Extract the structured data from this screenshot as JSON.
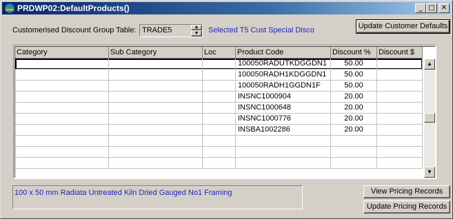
{
  "window": {
    "title": "PRDWP02:DefaultProducts()",
    "min_glyph": "_",
    "max_glyph": "□",
    "close_glyph": "✕"
  },
  "discount_group": {
    "label": "Customerised Discount Group Table:",
    "value": "TRADE5",
    "selected_text": "Selected T5 Cust Special Disco"
  },
  "buttons": {
    "update_customer_defaults": "Update Customer Defaults",
    "view_pricing_records": "View Pricing Records",
    "update_pricing_records": "Update Pricing Records"
  },
  "table": {
    "columns": [
      "Category",
      "Sub Category",
      "Loc",
      "Product Code",
      "Discount %",
      "Discount $"
    ],
    "rows": [
      [
        "",
        "",
        "",
        "100050RADUTKDGGDN1",
        "50.00",
        ""
      ],
      [
        "",
        "",
        "",
        "100050RADH1KDGGDN1",
        "50.00",
        ""
      ],
      [
        "",
        "",
        "",
        "100050RADH1GGDN1F",
        "50.00",
        ""
      ],
      [
        "",
        "",
        "",
        "INSNC1000904",
        "20.00",
        ""
      ],
      [
        "",
        "",
        "",
        "INSNC1000648",
        "20.00",
        ""
      ],
      [
        "",
        "",
        "",
        "INSNC1000776",
        "20.00",
        ""
      ],
      [
        "",
        "",
        "",
        "INSBA1002286",
        "20.00",
        ""
      ],
      [
        "",
        "",
        "",
        "",
        "",
        ""
      ],
      [
        "",
        "",
        "",
        "",
        "",
        ""
      ],
      [
        "",
        "",
        "",
        "",
        "",
        ""
      ]
    ]
  },
  "description": "100 x 50 mm Radiata Untreated Kiln Dried Gauged No1 Framing",
  "scroll": {
    "up_glyph": "▲",
    "down_glyph": "▼"
  },
  "colors": {
    "title_start": "#0a246a",
    "accent_text": "#1f24c0"
  }
}
